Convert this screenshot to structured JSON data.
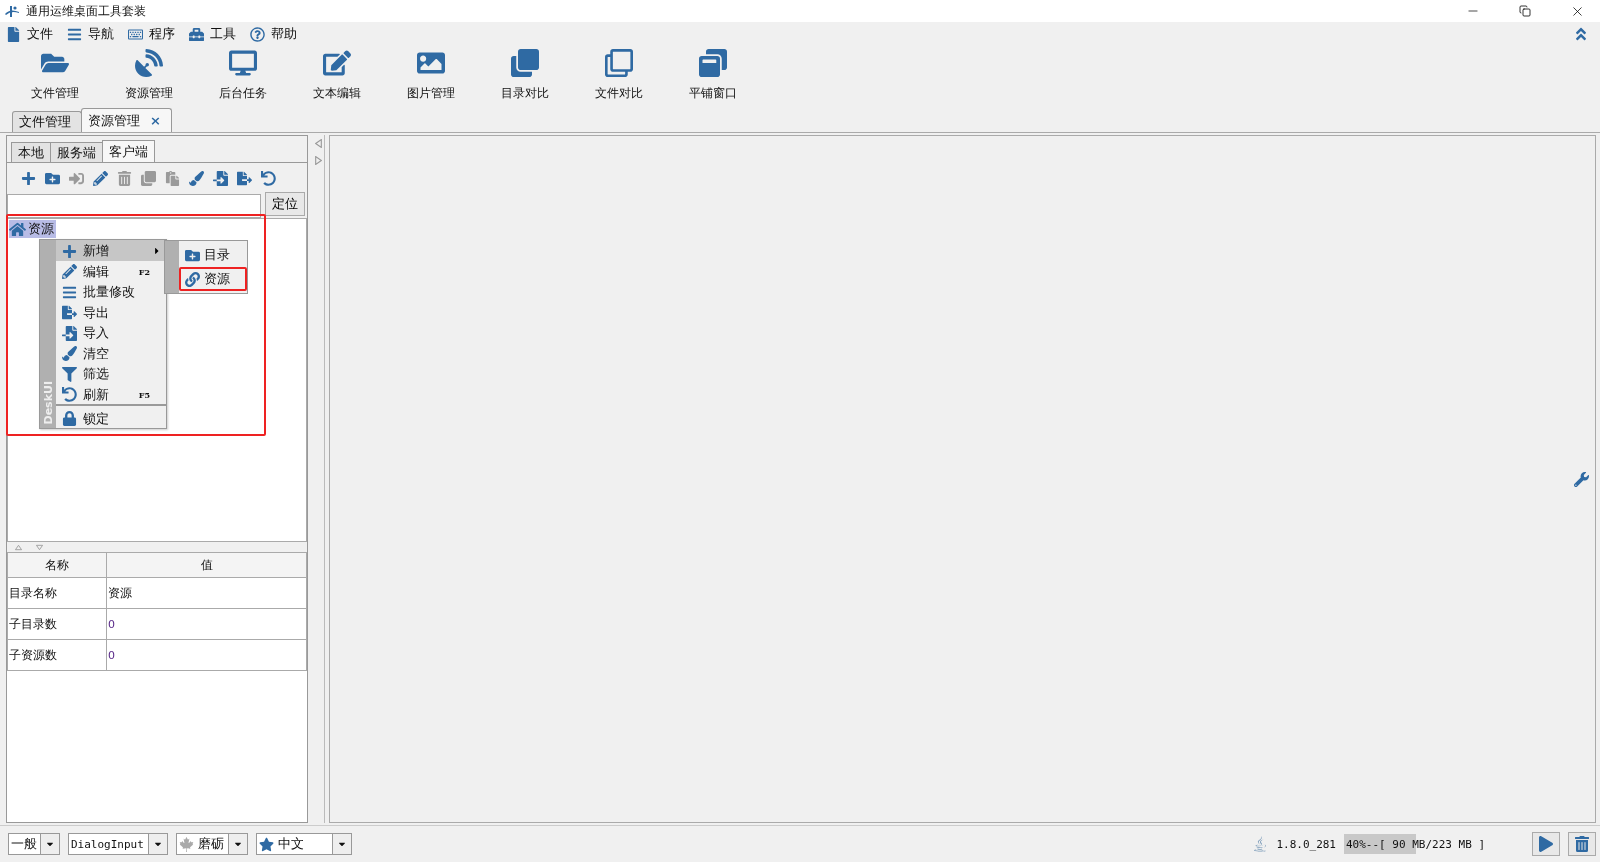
{
  "window": {
    "title": "通用运维桌面工具套装"
  },
  "menu": [
    {
      "label": "文件"
    },
    {
      "label": "导航"
    },
    {
      "label": "程序"
    },
    {
      "label": "工具"
    },
    {
      "label": "帮助"
    }
  ],
  "toolbar": [
    {
      "label": "文件管理"
    },
    {
      "label": "资源管理"
    },
    {
      "label": "后台任务"
    },
    {
      "label": "文本编辑"
    },
    {
      "label": "图片管理"
    },
    {
      "label": "目录对比"
    },
    {
      "label": "文件对比"
    },
    {
      "label": "平铺窗口"
    }
  ],
  "doc_tabs": [
    {
      "label": "文件管理",
      "selected": false
    },
    {
      "label": "资源管理",
      "selected": true,
      "close": "×"
    }
  ],
  "left_panel": {
    "tabs": [
      {
        "label": "本地",
        "selected": false
      },
      {
        "label": "服务端",
        "selected": false
      },
      {
        "label": "客户端",
        "selected": true
      }
    ],
    "tools": [
      {
        "disabled": false
      },
      {
        "disabled": false
      },
      {
        "disabled": true
      },
      {
        "disabled": false
      },
      {
        "disabled": true
      },
      {
        "disabled": true
      },
      {
        "disabled": true
      },
      {
        "disabled": false
      },
      {
        "disabled": false
      },
      {
        "disabled": false
      },
      {
        "disabled": false
      }
    ],
    "locate_button": "定位",
    "tree": {
      "annotated": true,
      "items": [
        {
          "label": "资源",
          "selected": true
        }
      ]
    },
    "context_menu": {
      "side_label": "DeskUI",
      "items": [
        {
          "label": "新增",
          "highlighted": true,
          "has_submenu": true,
          "separator_before": false
        },
        {
          "label": "编辑",
          "shortcut": "F2",
          "highlighted": false,
          "has_submenu": false,
          "separator_before": false
        },
        {
          "label": "批量修改",
          "highlighted": false,
          "has_submenu": false,
          "separator_before": false
        },
        {
          "label": "导出",
          "highlighted": false,
          "has_submenu": false,
          "separator_before": false
        },
        {
          "label": "导入",
          "highlighted": false,
          "has_submenu": false,
          "separator_before": false
        },
        {
          "label": "清空",
          "highlighted": false,
          "has_submenu": false,
          "separator_before": false
        },
        {
          "label": "筛选",
          "highlighted": false,
          "has_submenu": false,
          "separator_before": false
        },
        {
          "label": "刷新",
          "shortcut": "F5",
          "highlighted": false,
          "has_submenu": false,
          "separator_before": false
        },
        {
          "label": "锁定",
          "highlighted": false,
          "has_submenu": false,
          "separator_before": true
        }
      ]
    },
    "submenu": {
      "items": [
        {
          "label": "目录",
          "annotated": false
        },
        {
          "label": "资源",
          "annotated": true
        }
      ]
    },
    "properties": {
      "columns": [
        "名称",
        "值"
      ],
      "rows": [
        {
          "name": "目录名称",
          "value": "资源",
          "numeric": false
        },
        {
          "name": "子目录数",
          "value": "0",
          "numeric": true
        },
        {
          "name": "子资源数",
          "value": "0",
          "numeric": true
        }
      ]
    }
  },
  "status_bar": {
    "selects": [
      {
        "value": "一般",
        "mono": false
      },
      {
        "value": "DialogInput",
        "mono": true
      },
      {
        "value": "磨砺",
        "mono": false
      },
      {
        "value": "中文",
        "mono": false
      }
    ],
    "java_version": "1.8.0_281",
    "memory": {
      "text": "40%--[ 90 MB/223 MB ]",
      "level": 0.4
    }
  }
}
